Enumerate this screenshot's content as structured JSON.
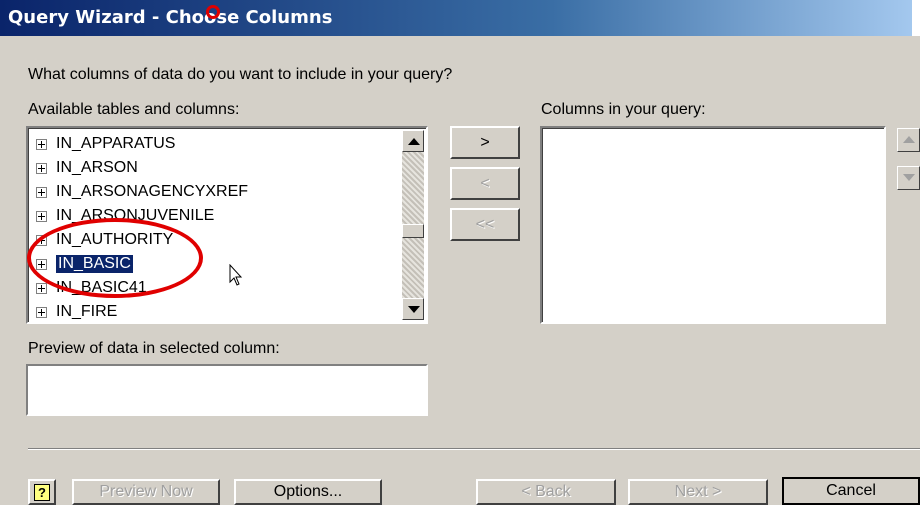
{
  "window": {
    "title": "Query Wizard - Choose Columns"
  },
  "prompt": "What columns of data do you want to include in your query?",
  "available": {
    "label": "Available tables and columns:",
    "items": [
      "IN_APPARATUS",
      "IN_ARSON",
      "IN_ARSONAGENCYXREF",
      "IN_ARSONJUVENILE",
      "IN_AUTHORITY",
      "IN_BASIC",
      "IN_BASIC41",
      "IN_FIRE"
    ],
    "selected": "IN_BASIC"
  },
  "query_columns": {
    "label": "Columns in your query:"
  },
  "move_buttons": {
    "add": ">",
    "remove": "<",
    "remove_all": "<<"
  },
  "preview": {
    "label": "Preview of data in selected column:",
    "value": ""
  },
  "footer": {
    "help": "?",
    "preview_now": "Preview Now",
    "options": "Options...",
    "back": "< Back",
    "next": "Next >",
    "cancel": "Cancel"
  },
  "annotation_color": "#e00000",
  "icons": [
    "expand-plus-icon",
    "scroll-up-arrow-icon",
    "scroll-down-arrow-icon",
    "mouse-pointer-icon"
  ]
}
